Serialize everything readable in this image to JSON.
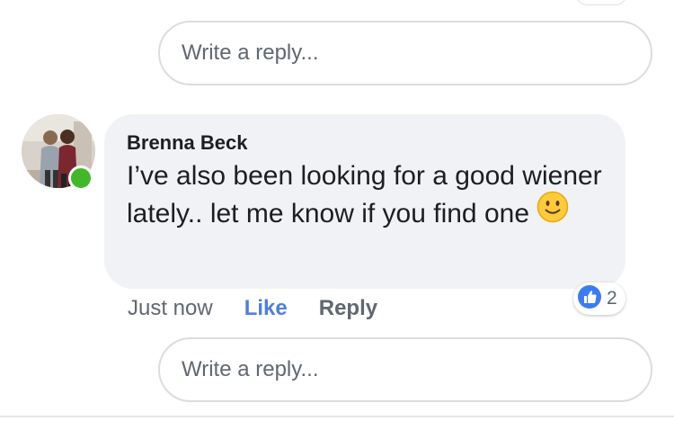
{
  "reply_box_top": {
    "placeholder": "Write a reply..."
  },
  "comment": {
    "author": "Brenna Beck",
    "text": "I’ve also been looking for a good wiener lately.. let me know if you find one",
    "emoji": "slightly-smiling-face-icon",
    "timestamp": "Just now",
    "like_label": "Like",
    "reply_label": "Reply",
    "reaction_count": "2",
    "reaction_type": "like-icon",
    "author_online": true
  },
  "reply_box_bottom": {
    "placeholder": "Write a reply..."
  },
  "colors": {
    "bubble": "#f0f2f5",
    "like_blue": "#4f80d8",
    "online_green": "#42b72a",
    "meta_gray": "#606770",
    "border_gray": "#dadde1"
  }
}
